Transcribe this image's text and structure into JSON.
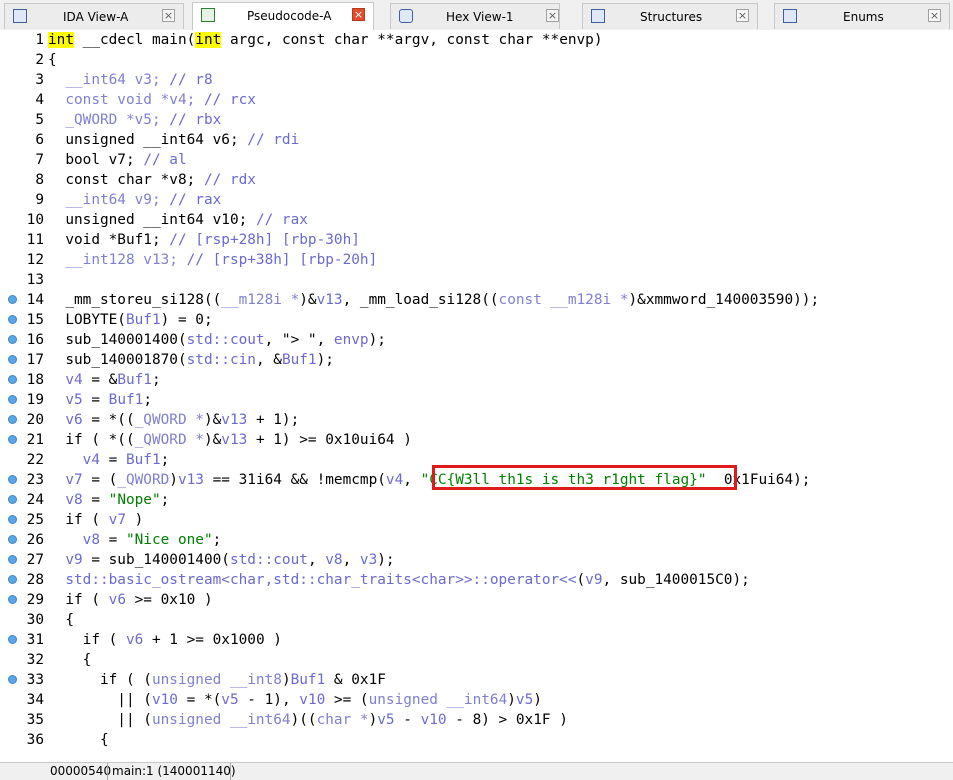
{
  "tabs": [
    {
      "label": "IDA View-A",
      "icon": "ida-view-icon"
    },
    {
      "label": "Pseudocode-A",
      "icon": "pseudocode-icon",
      "active": true
    },
    {
      "label": "Hex View-1",
      "icon": "hex-view-icon"
    },
    {
      "label": "Structures",
      "icon": "structures-icon"
    },
    {
      "label": "Enums",
      "icon": "enums-icon"
    }
  ],
  "close_glyph": "×",
  "code_lines": [
    {
      "n": "1",
      "bp": false,
      "segs": [
        [
          "hl",
          "int"
        ],
        [
          "t",
          " __cdecl main("
        ],
        [
          "hl",
          "int"
        ],
        [
          "t",
          " argc, const char **argv, const char **envp)"
        ]
      ]
    },
    {
      "n": "2",
      "bp": false,
      "segs": [
        [
          "t",
          "{"
        ]
      ]
    },
    {
      "n": "3",
      "bp": false,
      "segs": [
        [
          "c",
          "  __int64 v3; "
        ],
        [
          "v",
          "// r8"
        ]
      ]
    },
    {
      "n": "4",
      "bp": false,
      "segs": [
        [
          "c",
          "  const void *v4; "
        ],
        [
          "v",
          "// rcx"
        ]
      ]
    },
    {
      "n": "5",
      "bp": false,
      "segs": [
        [
          "c",
          "  _QWORD *v5; "
        ],
        [
          "v",
          "// rbx"
        ]
      ]
    },
    {
      "n": "6",
      "bp": false,
      "segs": [
        [
          "t",
          "  unsigned __int64 v6; "
        ],
        [
          "v",
          "// rdi"
        ]
      ]
    },
    {
      "n": "7",
      "bp": false,
      "segs": [
        [
          "t",
          "  bool v7; "
        ],
        [
          "v",
          "// al"
        ]
      ]
    },
    {
      "n": "8",
      "bp": false,
      "segs": [
        [
          "t",
          "  const char *v8; "
        ],
        [
          "v",
          "// rdx"
        ]
      ]
    },
    {
      "n": "9",
      "bp": false,
      "segs": [
        [
          "c",
          "  __int64 v9; "
        ],
        [
          "v",
          "// rax"
        ]
      ]
    },
    {
      "n": "10",
      "bp": false,
      "segs": [
        [
          "t",
          "  unsigned __int64 v10; "
        ],
        [
          "v",
          "// rax"
        ]
      ]
    },
    {
      "n": "11",
      "bp": false,
      "segs": [
        [
          "t",
          "  void *Buf1; "
        ],
        [
          "v",
          "// [rsp+28h] [rbp-30h]"
        ]
      ]
    },
    {
      "n": "12",
      "bp": false,
      "segs": [
        [
          "c",
          "  __int128 v13; "
        ],
        [
          "v",
          "// [rsp+38h] [rbp-20h]"
        ]
      ]
    },
    {
      "n": "13",
      "bp": false,
      "segs": [
        [
          "t",
          ""
        ]
      ]
    },
    {
      "n": "14",
      "bp": true,
      "segs": [
        [
          "t",
          "  _mm_storeu_si128(("
        ],
        [
          "c",
          "__m128i *"
        ],
        [
          "t",
          ")&"
        ],
        [
          "v",
          "v13"
        ],
        [
          "t",
          ", _mm_load_si128(("
        ],
        [
          "c",
          "const __m128i *"
        ],
        [
          "t",
          ")&xmmword_140003590));"
        ]
      ]
    },
    {
      "n": "15",
      "bp": true,
      "segs": [
        [
          "t",
          "  LOBYTE("
        ],
        [
          "v",
          "Buf1"
        ],
        [
          "t",
          ") = 0;"
        ]
      ]
    },
    {
      "n": "16",
      "bp": true,
      "segs": [
        [
          "t",
          "  sub_140001400("
        ],
        [
          "v",
          "std::cout"
        ],
        [
          "t",
          ", \"> \", "
        ],
        [
          "v",
          "envp"
        ],
        [
          "t",
          ");"
        ]
      ]
    },
    {
      "n": "17",
      "bp": true,
      "segs": [
        [
          "t",
          "  sub_140001870("
        ],
        [
          "v",
          "std::cin"
        ],
        [
          "t",
          ", &"
        ],
        [
          "v",
          "Buf1"
        ],
        [
          "t",
          ");"
        ]
      ]
    },
    {
      "n": "18",
      "bp": true,
      "segs": [
        [
          "t",
          "  "
        ],
        [
          "v",
          "v4"
        ],
        [
          "t",
          " = &"
        ],
        [
          "v",
          "Buf1"
        ],
        [
          "t",
          ";"
        ]
      ]
    },
    {
      "n": "19",
      "bp": true,
      "segs": [
        [
          "t",
          "  "
        ],
        [
          "v",
          "v5"
        ],
        [
          "t",
          " = "
        ],
        [
          "v",
          "Buf1"
        ],
        [
          "t",
          ";"
        ]
      ]
    },
    {
      "n": "20",
      "bp": true,
      "segs": [
        [
          "t",
          "  "
        ],
        [
          "v",
          "v6"
        ],
        [
          "t",
          " = *(("
        ],
        [
          "c",
          "_QWORD *"
        ],
        [
          "t",
          ")&"
        ],
        [
          "v",
          "v13"
        ],
        [
          "t",
          " + 1);"
        ]
      ]
    },
    {
      "n": "21",
      "bp": true,
      "segs": [
        [
          "t",
          "  if ( *(("
        ],
        [
          "c",
          "_QWORD *"
        ],
        [
          "t",
          ")&"
        ],
        [
          "v",
          "v13"
        ],
        [
          "t",
          " + 1) >= 0x10ui64 )"
        ]
      ]
    },
    {
      "n": "22",
      "bp": false,
      "segs": [
        [
          "t",
          "    "
        ],
        [
          "v",
          "v4"
        ],
        [
          "t",
          " = "
        ],
        [
          "v",
          "Buf1"
        ],
        [
          "t",
          ";"
        ]
      ]
    },
    {
      "n": "23",
      "bp": true,
      "segs": [
        [
          "t",
          "  "
        ],
        [
          "v",
          "v7"
        ],
        [
          "t",
          " = ("
        ],
        [
          "c",
          "_QWORD"
        ],
        [
          "t",
          ")"
        ],
        [
          "v",
          "v13"
        ],
        [
          "t",
          " == 31i64 && !memcmp("
        ],
        [
          "v",
          "v4"
        ],
        [
          "t",
          ", "
        ],
        [
          "s",
          "\"CC{W3ll_th1s_is_th3_r1ght_flag}\""
        ],
        [
          "t",
          "  0x1Fui64);"
        ]
      ]
    },
    {
      "n": "24",
      "bp": true,
      "segs": [
        [
          "t",
          "  "
        ],
        [
          "v",
          "v8"
        ],
        [
          "t",
          " = "
        ],
        [
          "s",
          "\"Nope\""
        ],
        [
          "t",
          ";"
        ]
      ]
    },
    {
      "n": "25",
      "bp": true,
      "segs": [
        [
          "t",
          "  if ( "
        ],
        [
          "v",
          "v7"
        ],
        [
          "t",
          " )"
        ]
      ]
    },
    {
      "n": "26",
      "bp": true,
      "segs": [
        [
          "t",
          "    "
        ],
        [
          "v",
          "v8"
        ],
        [
          "t",
          " = "
        ],
        [
          "s",
          "\"Nice one\""
        ],
        [
          "t",
          ";"
        ]
      ]
    },
    {
      "n": "27",
      "bp": true,
      "segs": [
        [
          "t",
          "  "
        ],
        [
          "v",
          "v9"
        ],
        [
          "t",
          " = sub_140001400("
        ],
        [
          "v",
          "std::cout"
        ],
        [
          "t",
          ", "
        ],
        [
          "v",
          "v8"
        ],
        [
          "t",
          ", "
        ],
        [
          "v",
          "v3"
        ],
        [
          "t",
          ");"
        ]
      ]
    },
    {
      "n": "28",
      "bp": true,
      "segs": [
        [
          "v",
          "  std::basic_ostream<char,std::char_traits<char>>::operator<<"
        ],
        [
          "t",
          "("
        ],
        [
          "v",
          "v9"
        ],
        [
          "t",
          ", sub_1400015C0);"
        ]
      ]
    },
    {
      "n": "29",
      "bp": true,
      "segs": [
        [
          "t",
          "  if ( "
        ],
        [
          "v",
          "v6"
        ],
        [
          "t",
          " >= 0x10 )"
        ]
      ]
    },
    {
      "n": "30",
      "bp": false,
      "segs": [
        [
          "t",
          "  {"
        ]
      ]
    },
    {
      "n": "31",
      "bp": true,
      "segs": [
        [
          "t",
          "    if ( "
        ],
        [
          "v",
          "v6"
        ],
        [
          "t",
          " + 1 >= 0x1000 )"
        ]
      ]
    },
    {
      "n": "32",
      "bp": false,
      "segs": [
        [
          "t",
          "    {"
        ]
      ]
    },
    {
      "n": "33",
      "bp": true,
      "segs": [
        [
          "t",
          "      if ( ("
        ],
        [
          "c",
          "unsigned __int8"
        ],
        [
          "t",
          ")"
        ],
        [
          "v",
          "Buf1"
        ],
        [
          "t",
          " & 0x1F"
        ]
      ]
    },
    {
      "n": "34",
      "bp": false,
      "segs": [
        [
          "t",
          "        || ("
        ],
        [
          "v",
          "v10"
        ],
        [
          "t",
          " = *("
        ],
        [
          "v",
          "v5"
        ],
        [
          "t",
          " - 1), "
        ],
        [
          "v",
          "v10"
        ],
        [
          "t",
          " >= ("
        ],
        [
          "c",
          "unsigned __int64"
        ],
        [
          "t",
          ")"
        ],
        [
          "v",
          "v5"
        ],
        [
          "t",
          ")"
        ]
      ]
    },
    {
      "n": "35",
      "bp": false,
      "segs": [
        [
          "t",
          "        || ("
        ],
        [
          "c",
          "unsigned __int64"
        ],
        [
          "t",
          ")(("
        ],
        [
          "c",
          "char *"
        ],
        [
          "t",
          ")"
        ],
        [
          "v",
          "v5"
        ],
        [
          "t",
          " - "
        ],
        [
          "v",
          "v10"
        ],
        [
          "t",
          " - 8) > 0x1F )"
        ]
      ]
    },
    {
      "n": "36",
      "bp": false,
      "segs": [
        [
          "t",
          "      {"
        ]
      ]
    }
  ],
  "status": {
    "offset": "00000540",
    "location": "main:1 (140001140)"
  }
}
